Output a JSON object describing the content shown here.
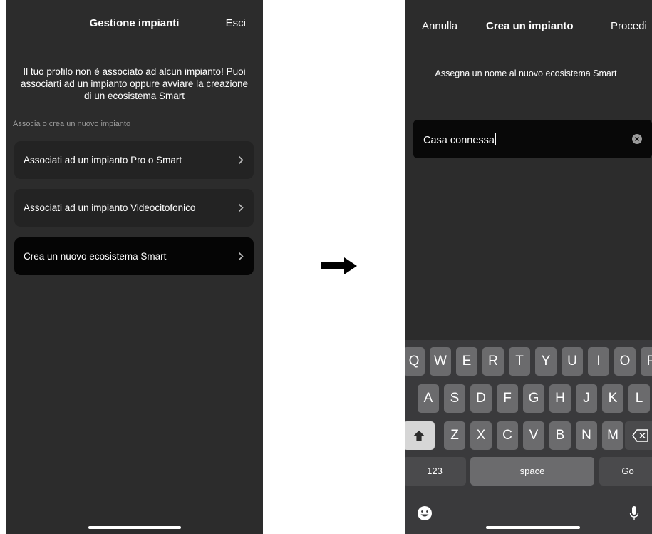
{
  "left_screen": {
    "title": "Gestione impianti",
    "exit_label": "Esci",
    "message": "Il tuo profilo non è associato ad alcun impianto! Puoi associarti ad un impianto oppure avviare la creazione di un ecosistema Smart",
    "section_label": "Associa o crea un nuovo impianto",
    "options": [
      {
        "label": "Associati ad un impianto Pro o Smart",
        "icon": "chevron-right-icon"
      },
      {
        "label": "Associati ad un impianto Videocitofonico",
        "icon": "chevron-right-icon"
      },
      {
        "label": "Crea un nuovo ecosistema Smart",
        "icon": "chevron-right-icon",
        "selected": true
      }
    ]
  },
  "transition_icon": "arrow-right-icon",
  "right_screen": {
    "cancel_label": "Annulla",
    "title": "Crea un impianto",
    "proceed_label": "Procedi",
    "message": "Assegna un nome al nuovo ecosistema Smart",
    "name_field": {
      "value": "Casa connessa",
      "clear_icon": "clear-circle-icon"
    },
    "keyboard": {
      "row1": [
        "Q",
        "W",
        "E",
        "R",
        "T",
        "Y",
        "U",
        "I",
        "O",
        "P"
      ],
      "row2": [
        "A",
        "S",
        "D",
        "F",
        "G",
        "H",
        "J",
        "K",
        "L"
      ],
      "row3": [
        "Z",
        "X",
        "C",
        "V",
        "B",
        "N",
        "M"
      ],
      "shift_icon": "shift-icon",
      "backspace_icon": "backspace-icon",
      "numbers_label": "123",
      "space_label": "space",
      "go_label": "Go",
      "emoji_icon": "emoji-icon",
      "microphone_icon": "microphone-icon"
    }
  },
  "colors": {
    "screen_background": "#2c2c2c",
    "option_background": "#232323",
    "option_selected_background": "#050505",
    "field_background": "#080808",
    "keyboard_background": "#3a3a3c",
    "key_background": "#6b6b6d",
    "key_dark_background": "#4a4a4c",
    "text": "#ffffff",
    "section_label": "#9a9a9a"
  }
}
